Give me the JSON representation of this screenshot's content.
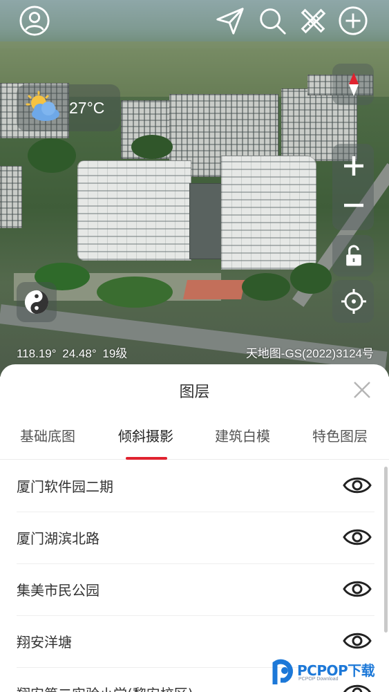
{
  "map": {
    "weather": {
      "icon": "partly-cloudy-icon",
      "temperature": "27°C"
    },
    "coordinates": {
      "longitude": "118.19°",
      "latitude": "24.48°",
      "zoom": "19级"
    },
    "copyright": "天地图-GS(2022)3124号",
    "toolbar": {
      "profile_icon": "user-circle-icon",
      "navigate_icon": "send-arrow-icon",
      "search_icon": "search-icon",
      "measure_icon": "ruler-pencil-icon",
      "add_icon": "plus-circle-icon"
    },
    "controls": [
      "compass-icon",
      "zoom-in-icon",
      "zoom-out-icon",
      "lock-icon",
      "locate-icon"
    ],
    "mode_icon": "yin-yang-icon"
  },
  "layer_panel": {
    "title": "图层",
    "close_icon": "close-icon",
    "tabs": [
      {
        "label": "基础底图",
        "active": false
      },
      {
        "label": "倾斜摄影",
        "active": true
      },
      {
        "label": "建筑白模",
        "active": false
      },
      {
        "label": "特色图层",
        "active": false
      }
    ],
    "accent_color": "#e0232f",
    "items": [
      {
        "label": "厦门软件园二期",
        "visibility_icon": "eye-icon"
      },
      {
        "label": "厦门湖滨北路",
        "visibility_icon": "eye-icon"
      },
      {
        "label": "集美市民公园",
        "visibility_icon": "eye-icon"
      },
      {
        "label": "翔安洋塘",
        "visibility_icon": "eye-icon"
      },
      {
        "label": "翔安第二实验小学(黎安校区)",
        "visibility_icon": "eye-icon"
      }
    ]
  },
  "watermark": {
    "brand": "PCPOP下载",
    "sub": "PCPOP Download"
  }
}
